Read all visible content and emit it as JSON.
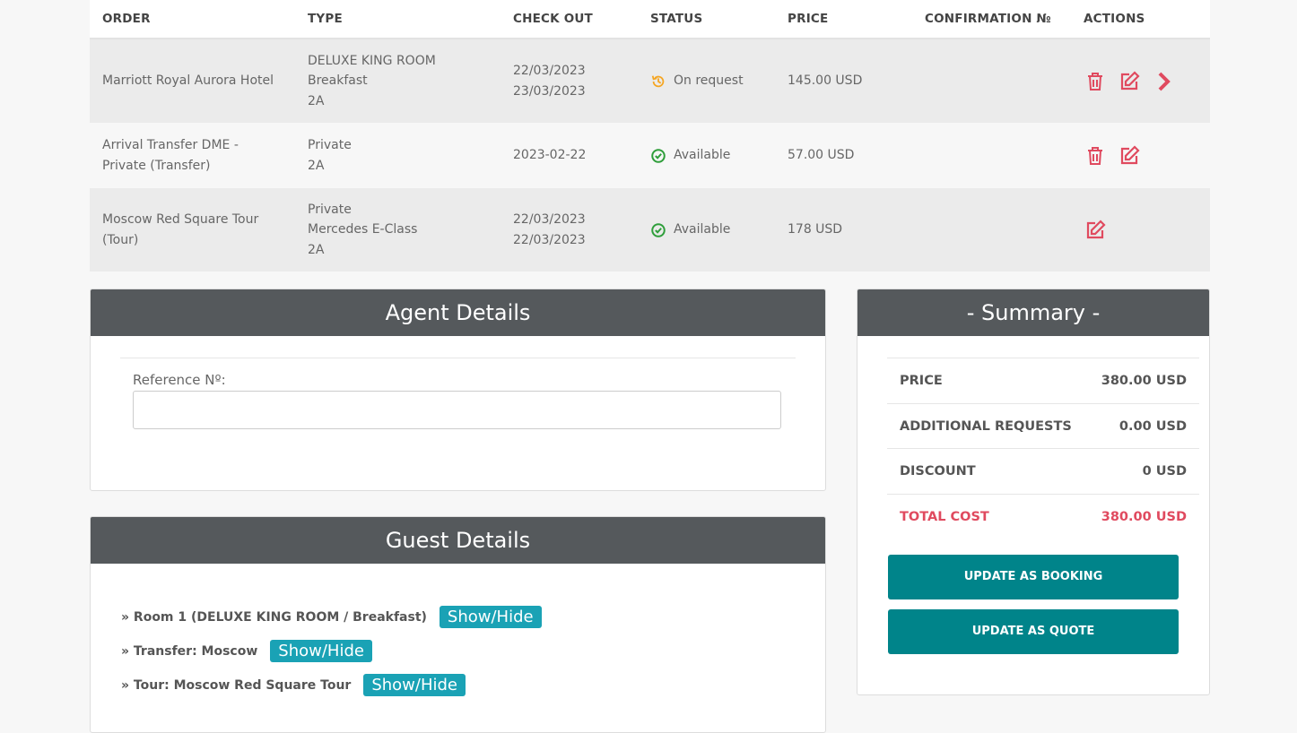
{
  "table": {
    "headers": [
      "ORDER",
      "TYPE",
      "CHECK OUT",
      "STATUS",
      "PRICE",
      "CONFIRMATION №",
      "ACTIONS"
    ],
    "rows": [
      {
        "order": [
          "Marriott Royal Aurora Hotel"
        ],
        "type": [
          "DELUXE KING ROOM",
          "Breakfast",
          "2A"
        ],
        "checkout": [
          "22/03/2023",
          "23/03/2023"
        ],
        "status": "On request",
        "status_icon": "clock-history-icon",
        "status_color": "#f5a623",
        "price": "145.00 USD",
        "confirmation": "",
        "actions": [
          "delete",
          "edit",
          "next"
        ]
      },
      {
        "order": [
          "Arrival Transfer DME -",
          "Private (Transfer)"
        ],
        "type": [
          "Private",
          "2A"
        ],
        "checkout": [
          "2023-02-22"
        ],
        "status": "Available",
        "status_icon": "check-circle-icon",
        "status_color": "#2e9e3a",
        "price": "57.00 USD",
        "confirmation": "",
        "actions": [
          "delete",
          "edit"
        ]
      },
      {
        "order": [
          "Moscow Red Square Tour",
          "(Tour)"
        ],
        "type": [
          "Private",
          "Mercedes E-Class",
          "2A"
        ],
        "checkout": [
          "22/03/2023",
          "22/03/2023"
        ],
        "status": "Available",
        "status_icon": "check-circle-icon",
        "status_color": "#2e9e3a",
        "price": "178 USD",
        "confirmation": "",
        "actions": [
          "edit"
        ]
      }
    ]
  },
  "agent": {
    "title": "Agent Details",
    "reference_label": "Reference Nº:",
    "reference_value": ""
  },
  "guest": {
    "title": "Guest Details",
    "items": [
      {
        "label": "» Room 1 (DELUXE KING ROOM / Breakfast)",
        "button": "Show/Hide"
      },
      {
        "label": "» Transfer: Moscow",
        "button": "Show/Hide"
      },
      {
        "label": "» Tour: Moscow Red Square Tour",
        "button": "Show/Hide"
      }
    ]
  },
  "summary": {
    "title": "- Summary -",
    "rows": [
      {
        "label": "PRICE",
        "value": "380.00 USD"
      },
      {
        "label": "ADDITIONAL REQUESTS",
        "value": "0.00 USD"
      },
      {
        "label": "DISCOUNT",
        "value": "0 USD"
      },
      {
        "label": "TOTAL COST",
        "value": "380.00 USD"
      }
    ],
    "btn_booking": "UPDATE AS BOOKING",
    "btn_quote": "UPDATE AS QUOTE"
  },
  "colors": {
    "accent": "#e04a5f",
    "panel_header": "#55595c",
    "primary_button": "#00848a",
    "show_button": "#1aa2b5"
  }
}
